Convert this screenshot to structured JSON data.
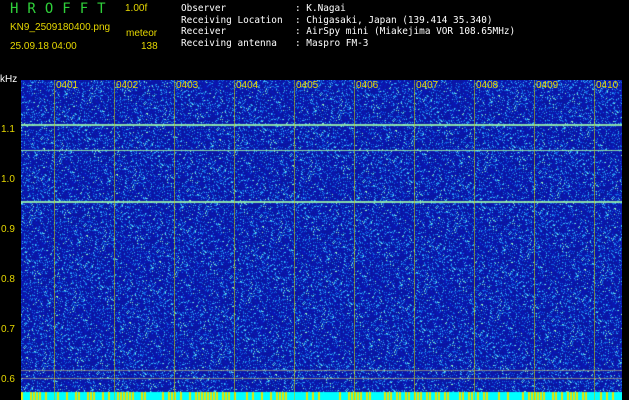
{
  "header": {
    "title": "HROFFT",
    "version": "1.00f",
    "filename": "KN9_2509180400.png",
    "meteor_label": "meteor",
    "datetime": "25.09.18 04:00",
    "meteor_count": "138",
    "info_rows": [
      {
        "label": "Observer",
        "value": "K.Nagai"
      },
      {
        "label": "Receiving Location",
        "value": "Chigasaki, Japan (139.414 35.340)"
      },
      {
        "label": "Receiver",
        "value": "AirSpy mini (Miakejima VOR 108.65MHz)"
      },
      {
        "label": "Receiving antenna",
        "value": "Maspro FM-3"
      }
    ]
  },
  "axis": {
    "unit": "kHz",
    "y_ticks": [
      "1.1",
      "1.0",
      "0.9",
      "0.8",
      "0.7",
      "0.6"
    ],
    "x_ticks": [
      "0401",
      "0402",
      "0403",
      "0404",
      "0405",
      "0406",
      "0407",
      "0408",
      "0409",
      "0410"
    ]
  },
  "colors": {
    "background": "#000000",
    "spectrogram_base": "#0d1aa8",
    "noise": "#4aa3ff",
    "carrier": "#7fffd0",
    "text_yellow": "#e6d800",
    "title_green": "#2fd13a",
    "bottom_bar": "#00ffff"
  }
}
